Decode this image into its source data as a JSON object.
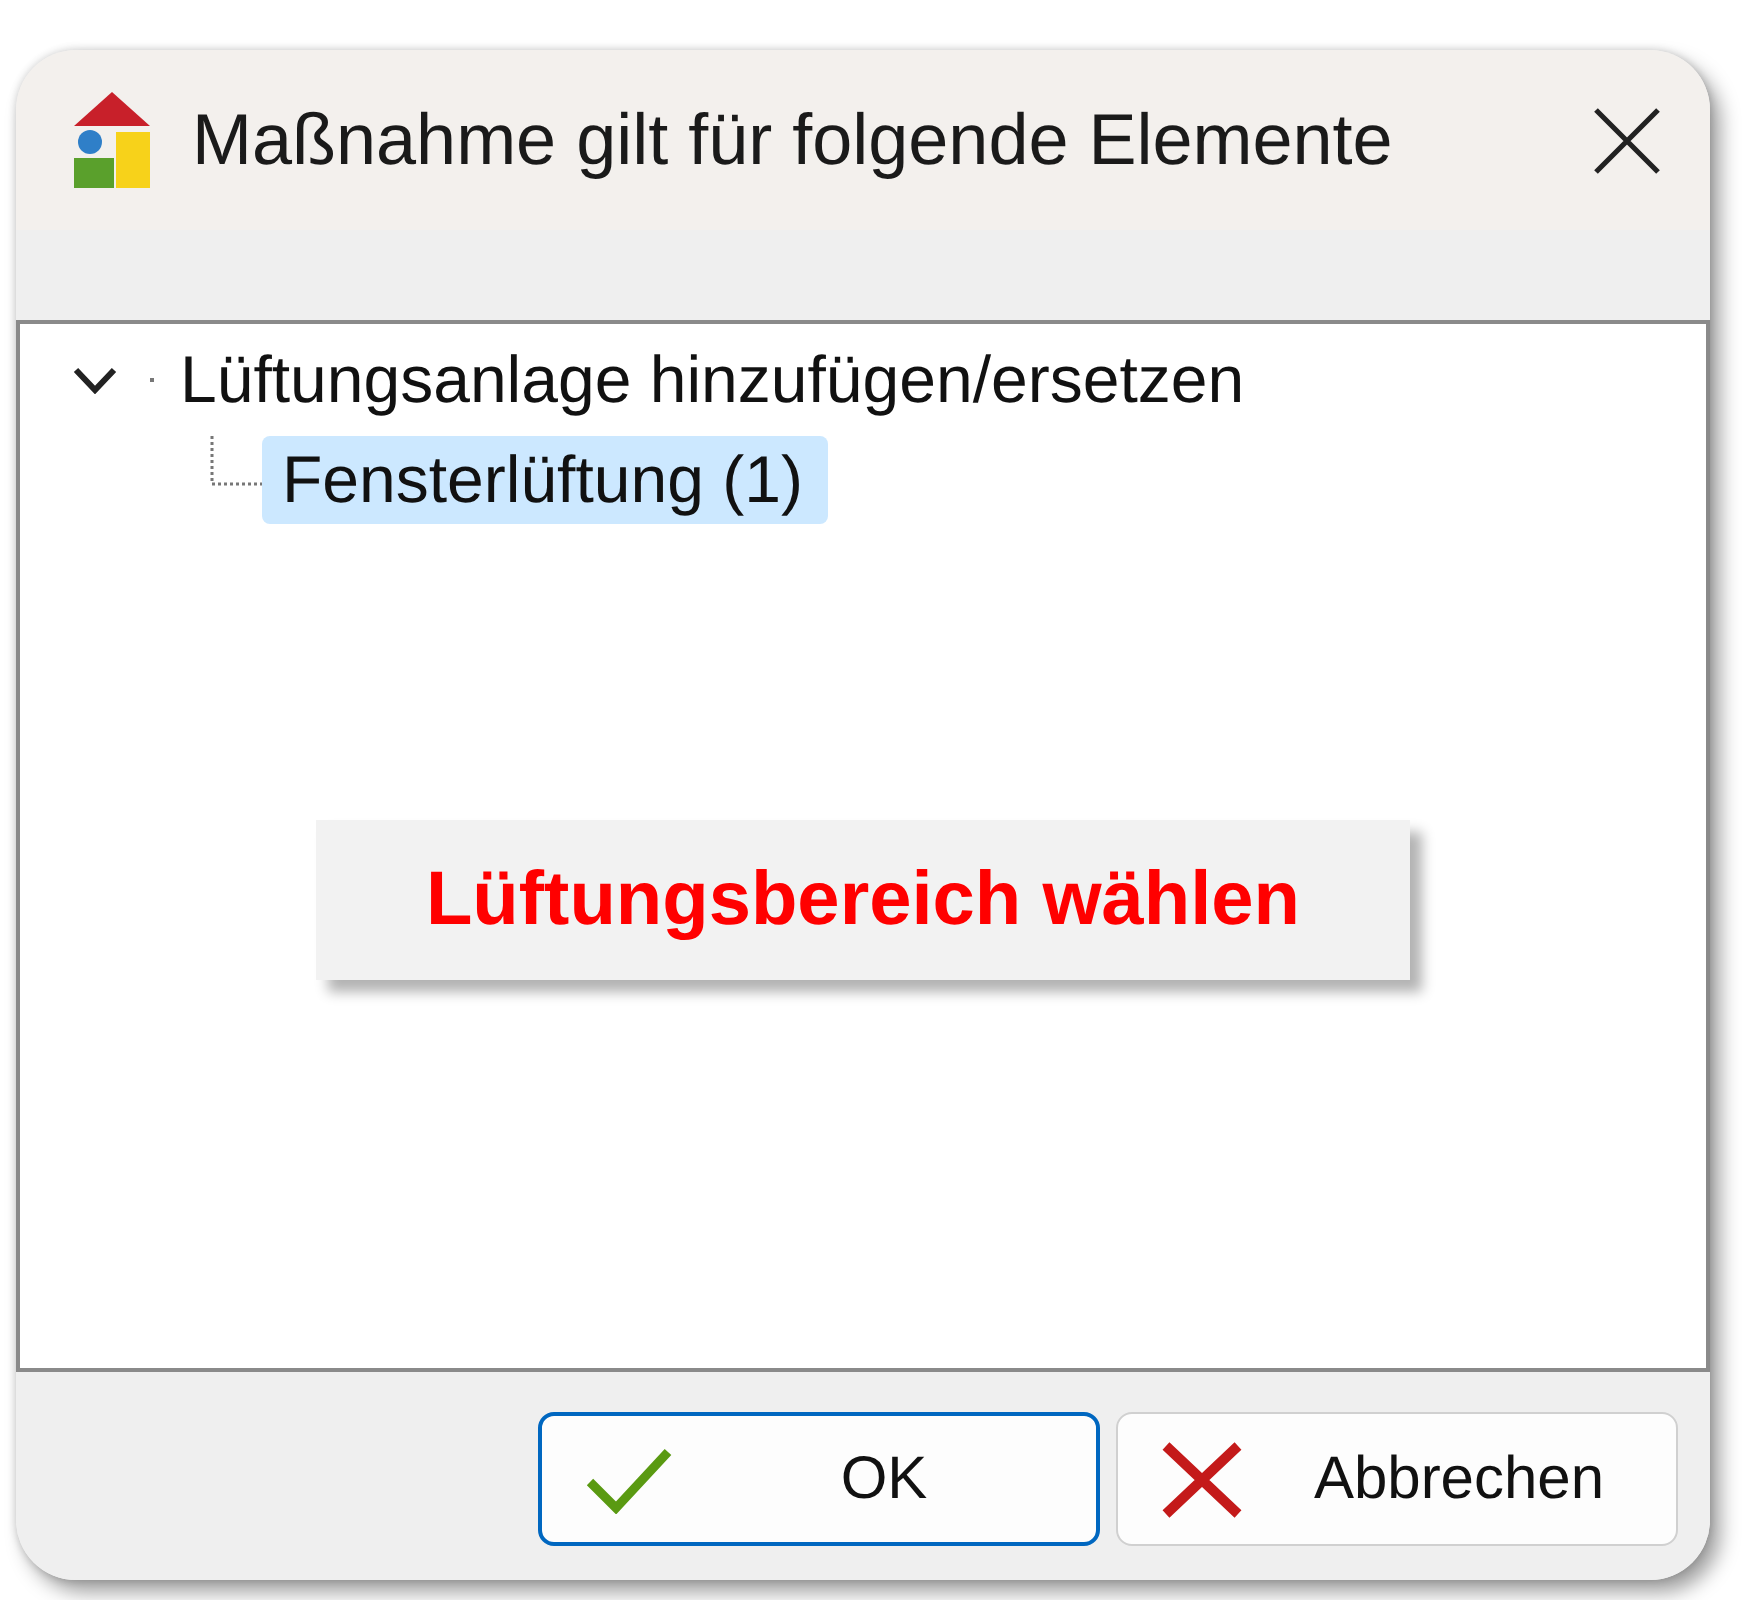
{
  "window": {
    "title": "Maßnahme gilt für folgende Elemente"
  },
  "tree": {
    "items": [
      {
        "label": "Lüftungsanlage hinzufügen/ersetzen",
        "expanded": true,
        "selected": false,
        "children": [
          {
            "label": "Fensterlüftung (1)",
            "selected": true
          }
        ]
      }
    ]
  },
  "callout": {
    "text": "Lüftungsbereich wählen"
  },
  "buttons": [
    {
      "label": "OK",
      "kind": "ok",
      "focused": true
    },
    {
      "label": "Abbrechen",
      "kind": "cancel",
      "focused": false
    }
  ]
}
